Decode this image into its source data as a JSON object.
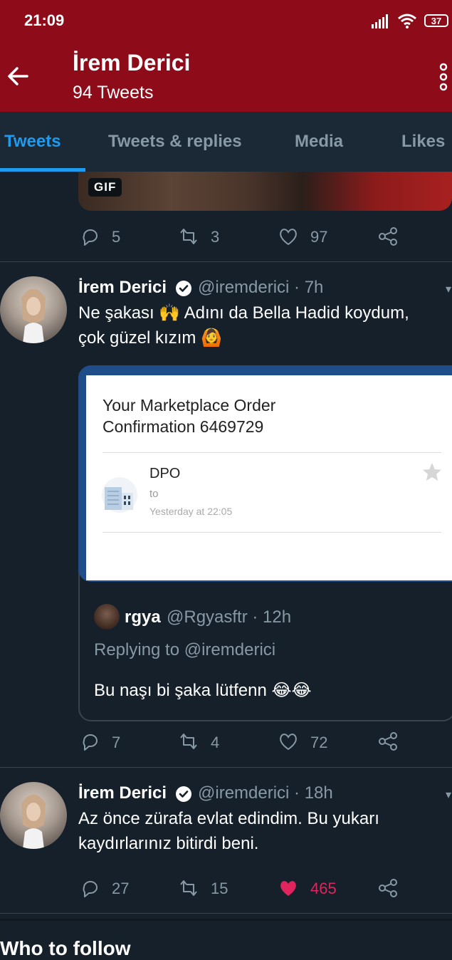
{
  "status_bar": {
    "time": "21:09",
    "battery": "37"
  },
  "header": {
    "name": "İrem Derici",
    "tweet_count": "94 Tweets"
  },
  "tabs": [
    {
      "label": "Tweets",
      "active": true
    },
    {
      "label": "Tweets & replies",
      "active": false
    },
    {
      "label": "Media",
      "active": false
    },
    {
      "label": "Likes",
      "active": false
    }
  ],
  "media_badge": "GIF",
  "tweet0_actions": {
    "replies": "5",
    "retweets": "3",
    "likes": "97"
  },
  "tweet1": {
    "name": "İrem Derici",
    "handle": "@iremderici · 7h",
    "text_line1": "Ne şakası 🙌 Adını da Bella Hadid koydum,",
    "text_line2": "çok güzel kızım 🙆",
    "email": {
      "subject_line1": "Your Marketplace Order",
      "subject_line2": "Confirmation 6469729",
      "sender": "DPO",
      "to": "to",
      "date": "Yesterday at 22:05"
    },
    "quote": {
      "name": "rgya",
      "handle": "@Rgyasftr · 12h",
      "replying": "Replying to @iremderici",
      "text": "Bu naşı bi şaka lütfenn 😂😂"
    },
    "actions": {
      "replies": "7",
      "retweets": "4",
      "likes": "72"
    }
  },
  "tweet2": {
    "name": "İrem Derici",
    "handle": "@iremderici · 18h",
    "text_line1": "Az önce zürafa evlat edindim. Bu yukarı",
    "text_line2": "kaydırlarınız bitirdi beni.",
    "actions": {
      "replies": "27",
      "retweets": "15",
      "likes": "465",
      "liked": true
    }
  },
  "who_to_follow": "Who to follow",
  "colors": {
    "header_bg": "#8e0b1a",
    "background": "#15202b",
    "accent": "#1d9bf0",
    "like": "#e0245e"
  }
}
